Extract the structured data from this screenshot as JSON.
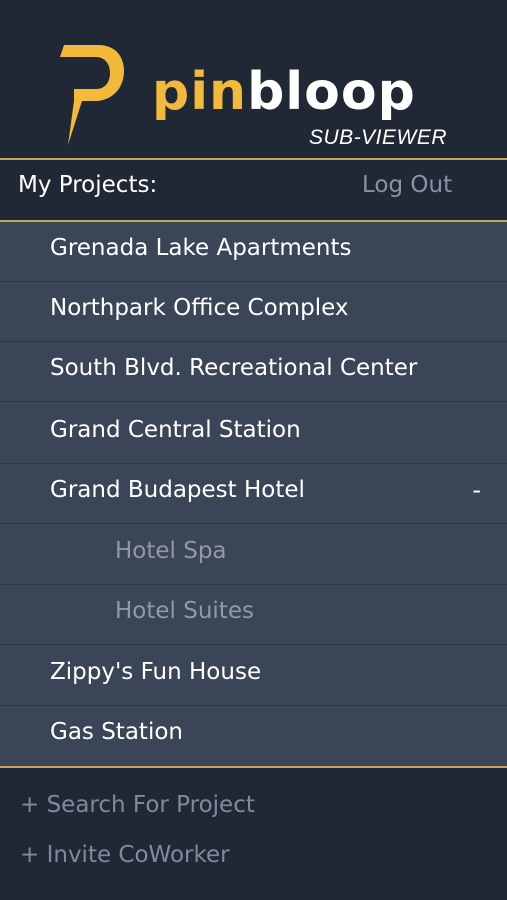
{
  "brand": {
    "name_part1": "pin",
    "name_part2": "bloop",
    "subtitle": "SUB-VIEWER",
    "accent_color": "#f2b93b"
  },
  "topbar": {
    "title": "My Projects:",
    "logout": "Log Out"
  },
  "projects": [
    {
      "label": "Grenada Lake Apartments",
      "level": "main"
    },
    {
      "label": "Northpark Office Complex",
      "level": "main"
    },
    {
      "label": "South Blvd. Recreational Center",
      "level": "main"
    },
    {
      "label": "Grand Central Station",
      "level": "main"
    },
    {
      "label": "Grand Budapest Hotel",
      "level": "main",
      "toggle": "-"
    },
    {
      "label": "Hotel Spa",
      "level": "sub"
    },
    {
      "label": "Hotel Suites",
      "level": "sub"
    },
    {
      "label": "Zippy's Fun House",
      "level": "main"
    },
    {
      "label": "Gas Station",
      "level": "main"
    }
  ],
  "footer": {
    "search": "+ Search For Project",
    "invite": "+ Invite CoWorker"
  }
}
